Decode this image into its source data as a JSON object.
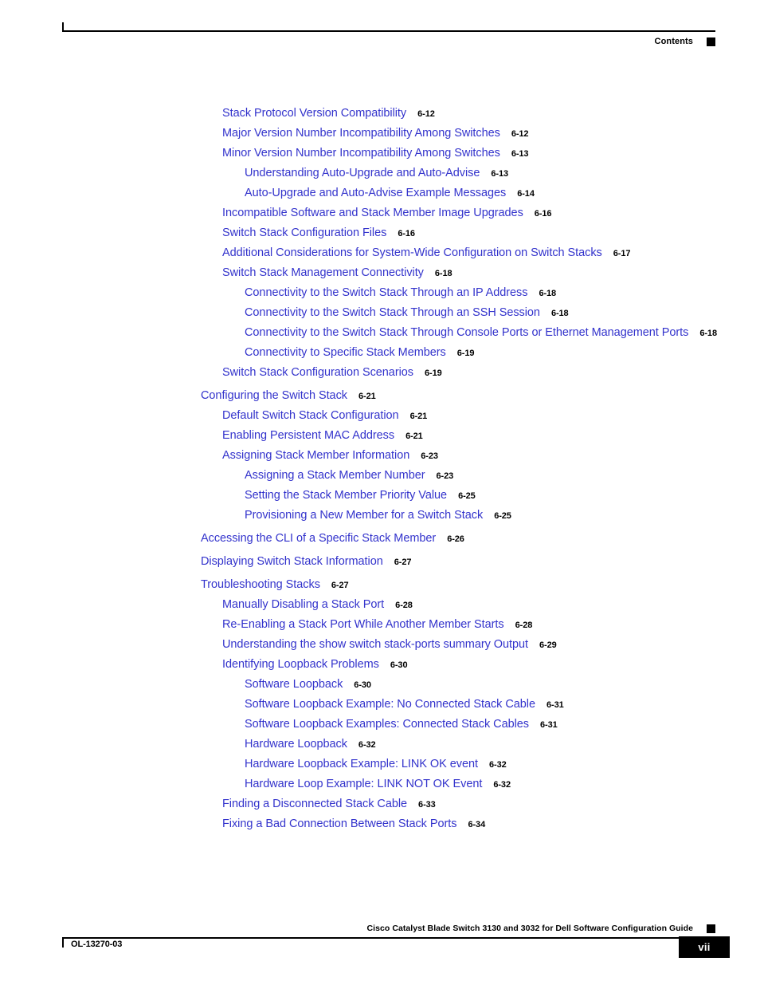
{
  "header": {
    "label": "Contents",
    "square_color": "#000000",
    "rule_color": "#000000"
  },
  "footer": {
    "guide_title": "Cisco Catalyst Blade Switch 3130 and 3032 for Dell Software Configuration Guide",
    "doc_number": "OL-13270-03",
    "page_number": "vii"
  },
  "colors": {
    "link": "#3333CC",
    "page_number": "#000000",
    "rule": "#000000"
  },
  "toc": {
    "entries": [
      {
        "level": 1,
        "title": "Stack Protocol Version Compatibility",
        "page": "6-12",
        "gap_before": false
      },
      {
        "level": 1,
        "title": "Major Version Number Incompatibility Among Switches",
        "page": "6-12",
        "gap_before": false
      },
      {
        "level": 1,
        "title": "Minor Version Number Incompatibility Among Switches",
        "page": "6-13",
        "gap_before": false
      },
      {
        "level": 2,
        "title": "Understanding Auto-Upgrade and Auto-Advise",
        "page": "6-13",
        "gap_before": false
      },
      {
        "level": 2,
        "title": "Auto-Upgrade and Auto-Advise Example Messages",
        "page": "6-14",
        "gap_before": false
      },
      {
        "level": 1,
        "title": "Incompatible Software and Stack Member Image Upgrades",
        "page": "6-16",
        "gap_before": false
      },
      {
        "level": 1,
        "title": "Switch Stack Configuration Files",
        "page": "6-16",
        "gap_before": false
      },
      {
        "level": 1,
        "title": "Additional Considerations for System-Wide Configuration on Switch Stacks",
        "page": "6-17",
        "gap_before": false
      },
      {
        "level": 1,
        "title": "Switch Stack Management Connectivity",
        "page": "6-18",
        "gap_before": false
      },
      {
        "level": 2,
        "title": "Connectivity to the Switch Stack Through an IP Address",
        "page": "6-18",
        "gap_before": false
      },
      {
        "level": 2,
        "title": "Connectivity to the Switch Stack Through an SSH Session",
        "page": "6-18",
        "gap_before": false
      },
      {
        "level": 2,
        "title": "Connectivity to the Switch Stack Through Console Ports or Ethernet Management Ports",
        "page": "6-18",
        "gap_before": false
      },
      {
        "level": 2,
        "title": "Connectivity to Specific Stack Members",
        "page": "6-19",
        "gap_before": false
      },
      {
        "level": 1,
        "title": "Switch Stack Configuration Scenarios",
        "page": "6-19",
        "gap_before": false
      },
      {
        "level": 0,
        "title": "Configuring the Switch Stack",
        "page": "6-21",
        "gap_before": true
      },
      {
        "level": 1,
        "title": "Default Switch Stack Configuration",
        "page": "6-21",
        "gap_before": false
      },
      {
        "level": 1,
        "title": "Enabling Persistent MAC Address",
        "page": "6-21",
        "gap_before": false
      },
      {
        "level": 1,
        "title": "Assigning Stack Member Information",
        "page": "6-23",
        "gap_before": false
      },
      {
        "level": 2,
        "title": "Assigning a Stack Member Number",
        "page": "6-23",
        "gap_before": false
      },
      {
        "level": 2,
        "title": "Setting the Stack Member Priority Value",
        "page": "6-25",
        "gap_before": false
      },
      {
        "level": 2,
        "title": "Provisioning a New Member for a Switch Stack",
        "page": "6-25",
        "gap_before": false
      },
      {
        "level": 0,
        "title": "Accessing the CLI of a Specific Stack Member",
        "page": "6-26",
        "gap_before": true
      },
      {
        "level": 0,
        "title": "Displaying Switch Stack Information",
        "page": "6-27",
        "gap_before": true
      },
      {
        "level": 0,
        "title": "Troubleshooting Stacks",
        "page": "6-27",
        "gap_before": true
      },
      {
        "level": 1,
        "title": "Manually Disabling a Stack Port",
        "page": "6-28",
        "gap_before": false
      },
      {
        "level": 1,
        "title": "Re-Enabling a Stack Port While Another Member Starts",
        "page": "6-28",
        "gap_before": false
      },
      {
        "level": 1,
        "title": "Understanding the show switch stack-ports summary Output",
        "page": "6-29",
        "gap_before": false
      },
      {
        "level": 1,
        "title": "Identifying Loopback Problems",
        "page": "6-30",
        "gap_before": false
      },
      {
        "level": 2,
        "title": "Software Loopback",
        "page": "6-30",
        "gap_before": false
      },
      {
        "level": 2,
        "title": "Software Loopback Example: No Connected Stack Cable",
        "page": "6-31",
        "gap_before": false
      },
      {
        "level": 2,
        "title": "Software Loopback Examples: Connected Stack Cables",
        "page": "6-31",
        "gap_before": false
      },
      {
        "level": 2,
        "title": "Hardware Loopback",
        "page": "6-32",
        "gap_before": false
      },
      {
        "level": 2,
        "title": "Hardware Loopback Example: LINK OK event",
        "page": "6-32",
        "gap_before": false
      },
      {
        "level": 2,
        "title": "Hardware Loop Example: LINK NOT OK Event",
        "page": "6-32",
        "gap_before": false
      },
      {
        "level": 1,
        "title": "Finding a Disconnected Stack Cable",
        "page": "6-33",
        "gap_before": false
      },
      {
        "level": 1,
        "title": "Fixing a Bad Connection Between Stack Ports",
        "page": "6-34",
        "gap_before": false
      }
    ]
  }
}
